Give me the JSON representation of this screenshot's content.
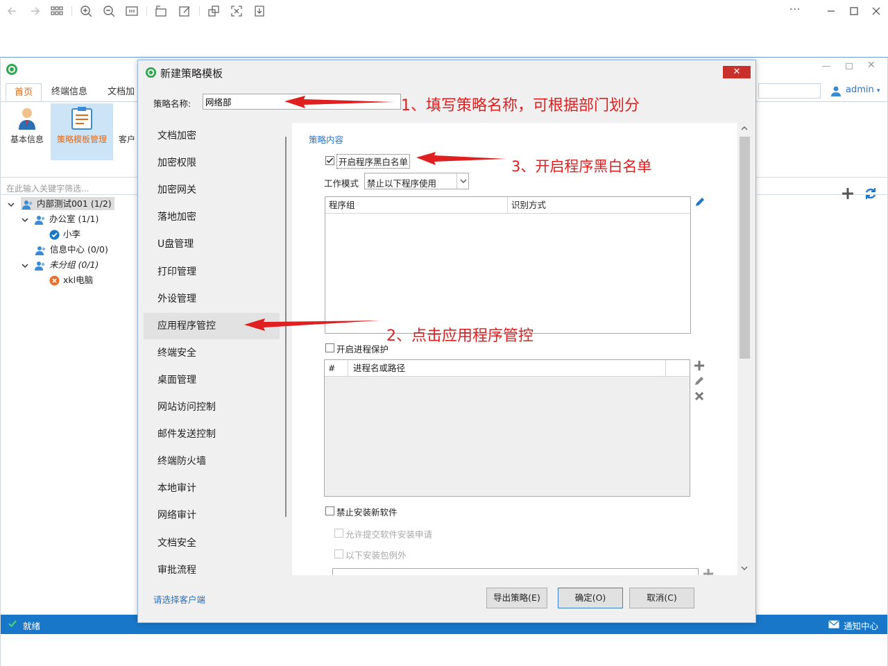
{
  "colors": {
    "accent_blue": "#1977c9",
    "accent_orange": "#e06a1a",
    "close_red": "#c9302c",
    "annotation_red": "#e02020",
    "link_blue": "#2a72c4"
  },
  "viewer_toolbar": {
    "icons": [
      "back-arrow-icon",
      "forward-arrow-icon",
      "grid-icon",
      "zoom-in-icon",
      "zoom-out-icon",
      "fit-icon",
      "rotate-icon",
      "edit-icon",
      "copy-icon",
      "fullscreen-icon",
      "download-icon",
      "more-icon",
      "minimize-icon",
      "maximize-icon",
      "close-icon"
    ],
    "more_label": "···"
  },
  "host": {
    "tabs": [
      {
        "label": "首页",
        "active": true
      },
      {
        "label": "终端信息"
      },
      {
        "label": "文档加"
      }
    ],
    "ribbon": [
      {
        "label": "基本信息"
      },
      {
        "label": "策略模板管理",
        "active": true
      },
      {
        "label": "客户"
      }
    ],
    "filter_placeholder": "在此输入关键字筛选...",
    "user": "admin",
    "user_caret": "▾",
    "tree": [
      {
        "label": "内部测试001 (1/2)",
        "expanded": true
      },
      {
        "label": "办公室 (1/1)",
        "expanded": true
      },
      {
        "label": "小李",
        "status": "online"
      },
      {
        "label": "信息中心 (0/0)"
      },
      {
        "label": "未分组 (0/1)",
        "expanded": true
      },
      {
        "label": "xkl电脑",
        "status": "offline"
      }
    ],
    "status_left": "就绪",
    "status_right": "通知中心"
  },
  "dialog": {
    "title": "新建策略模板",
    "close_label": "✕",
    "name_label": "策略名称:",
    "name_value": "网络部",
    "nav_items": [
      "文档加密",
      "加密权限",
      "加密网关",
      "落地加密",
      "U盘管理",
      "打印管理",
      "外设管理",
      "应用程序管控",
      "终端安全",
      "桌面管理",
      "网站访问控制",
      "邮件发送控制",
      "终端防火墙",
      "本地审计",
      "网络审计",
      "文档安全",
      "审批流程"
    ],
    "active_nav": 7,
    "content": {
      "section_title": "策略内容",
      "blackwhite_checkbox": {
        "label": "开启程序黑白名单",
        "checked": true
      },
      "work_mode_label": "工作模式",
      "work_mode_value": "禁止以下程序使用",
      "program_grid_cols": [
        "程序组",
        "识别方式"
      ],
      "process_protect": {
        "label": "开启进程保护",
        "checked": false
      },
      "process_grid_cols": [
        "#",
        "进程名或路径"
      ],
      "no_install": {
        "label": "禁止安装新软件",
        "checked": false
      },
      "allow_request": {
        "label": "允许提交软件安装申请",
        "checked": false
      },
      "install_except": {
        "label": "以下安装包例外",
        "checked": false
      }
    },
    "footer_link": "请选择客户端",
    "buttons": {
      "export": "导出策略(E)",
      "ok": "确定(O)",
      "cancel": "取消(C)"
    }
  },
  "annotations": {
    "step1": "1、填写策略名称，可根据部门划分",
    "step2": "2、点击应用程序管控",
    "step3": "3、开启程序黑白名单"
  }
}
